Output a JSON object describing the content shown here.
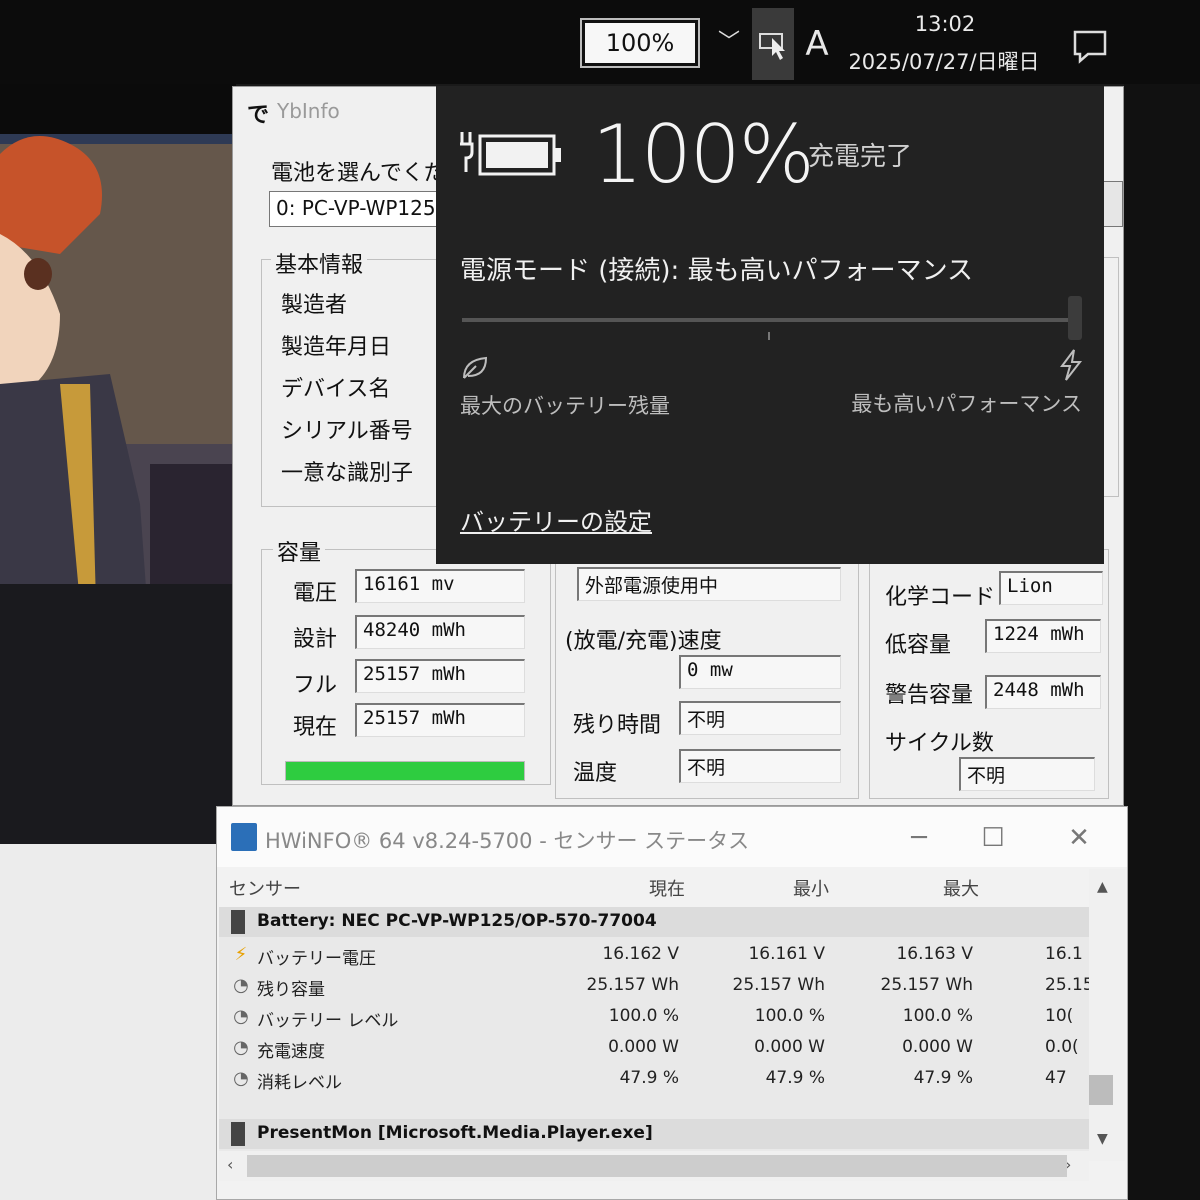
{
  "taskbar": {
    "zoom": "100%",
    "ime": "A",
    "time": "13:02",
    "date": "2025/07/27/日曜日"
  },
  "ybinfo": {
    "logo": "で",
    "title": "YbInfo",
    "select_label": "電池を選んでくだ",
    "selected_battery": "0: PC-VP-WP125",
    "basic_group": "基本情報",
    "basic_items": [
      "製造者",
      "製造年月日",
      "デバイス名",
      "シリアル番号",
      "一意な識別子"
    ],
    "capacity_group": "容量",
    "capacity": {
      "voltage_label": "電圧",
      "voltage": "16161 mv",
      "design_label": "設計",
      "design": "48240 mWh",
      "full_label": "フル",
      "full": "25157 mWh",
      "current_label": "現在",
      "current": "25157 mWh",
      "charge_fraction": 1.0
    },
    "power": {
      "source": "外部電源使用中",
      "rate_label": "(放電/充電)速度",
      "rate": "0 mw",
      "remaining_label": "残り時間",
      "remaining": "不明",
      "temp_label": "温度",
      "temp": "不明"
    },
    "chem": {
      "chem_label": "化学コード",
      "chem": "Lion",
      "low_label": "低容量",
      "low": "1224 mWh",
      "warn_label": "警告容量",
      "warn": "2448 mWh",
      "cycle_label": "サイクル数",
      "cycle": "不明"
    }
  },
  "flyout": {
    "percent": "100%",
    "status": "充電完了",
    "mode": "電源モード (接続): 最も高いパフォーマンス",
    "slider_level": 1.0,
    "left_label": "最大のバッテリー残量",
    "right_label": "最も高いパフォーマンス",
    "settings_link": "バッテリーの設定",
    "icons": {
      "battery": "battery-plug-icon",
      "leaf": "leaf-icon",
      "bolt": "bolt-icon"
    }
  },
  "hwinfo": {
    "title": "HWiNFO® 64 v8.24-5700 - センサー ステータス",
    "columns": [
      "センサー",
      "現在",
      "最小",
      "最大"
    ],
    "group1": "Battery: NEC PC-VP-WP125/OP-570-77004",
    "rows": [
      {
        "icon": "⚡",
        "name": "バッテリー電圧",
        "cur": "16.162 V",
        "min": "16.161 V",
        "max": "16.163 V",
        "avg": "16.1"
      },
      {
        "icon": "◔",
        "name": "残り容量",
        "cur": "25.157 Wh",
        "min": "25.157 Wh",
        "max": "25.157 Wh",
        "avg": "25.15"
      },
      {
        "icon": "◔",
        "name": "バッテリー レベル",
        "cur": "100.0 %",
        "min": "100.0 %",
        "max": "100.0 %",
        "avg": "10("
      },
      {
        "icon": "◔",
        "name": "充電速度",
        "cur": "0.000 W",
        "min": "0.000 W",
        "max": "0.000 W",
        "avg": "0.0("
      },
      {
        "icon": "◔",
        "name": "消耗レベル",
        "cur": "47.9 %",
        "min": "47.9 %",
        "max": "47.9 %",
        "avg": "47"
      }
    ],
    "group2": "PresentMon [Microsoft.Media.Player.exe]",
    "colors": {
      "accent": "#2b6fb8",
      "bolt": "#e8a000"
    }
  }
}
